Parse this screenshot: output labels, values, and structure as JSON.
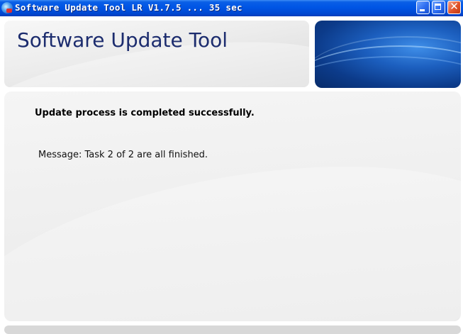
{
  "window": {
    "title": "Software Update Tool LR V1.7.5 ... 35 sec",
    "icon": "app-icon",
    "controls": {
      "minimize_icon": "minimize-icon",
      "maximize_icon": "maximize-icon",
      "close_glyph": "✕"
    },
    "colors": {
      "titlebar": "#0055e5",
      "close_button": "#e0532a"
    }
  },
  "header": {
    "title": "Software Update Tool",
    "title_color": "#1c2c6e"
  },
  "content": {
    "status": "Update process is completed successfully.",
    "message": "Message: Task 2 of 2 are all finished."
  }
}
